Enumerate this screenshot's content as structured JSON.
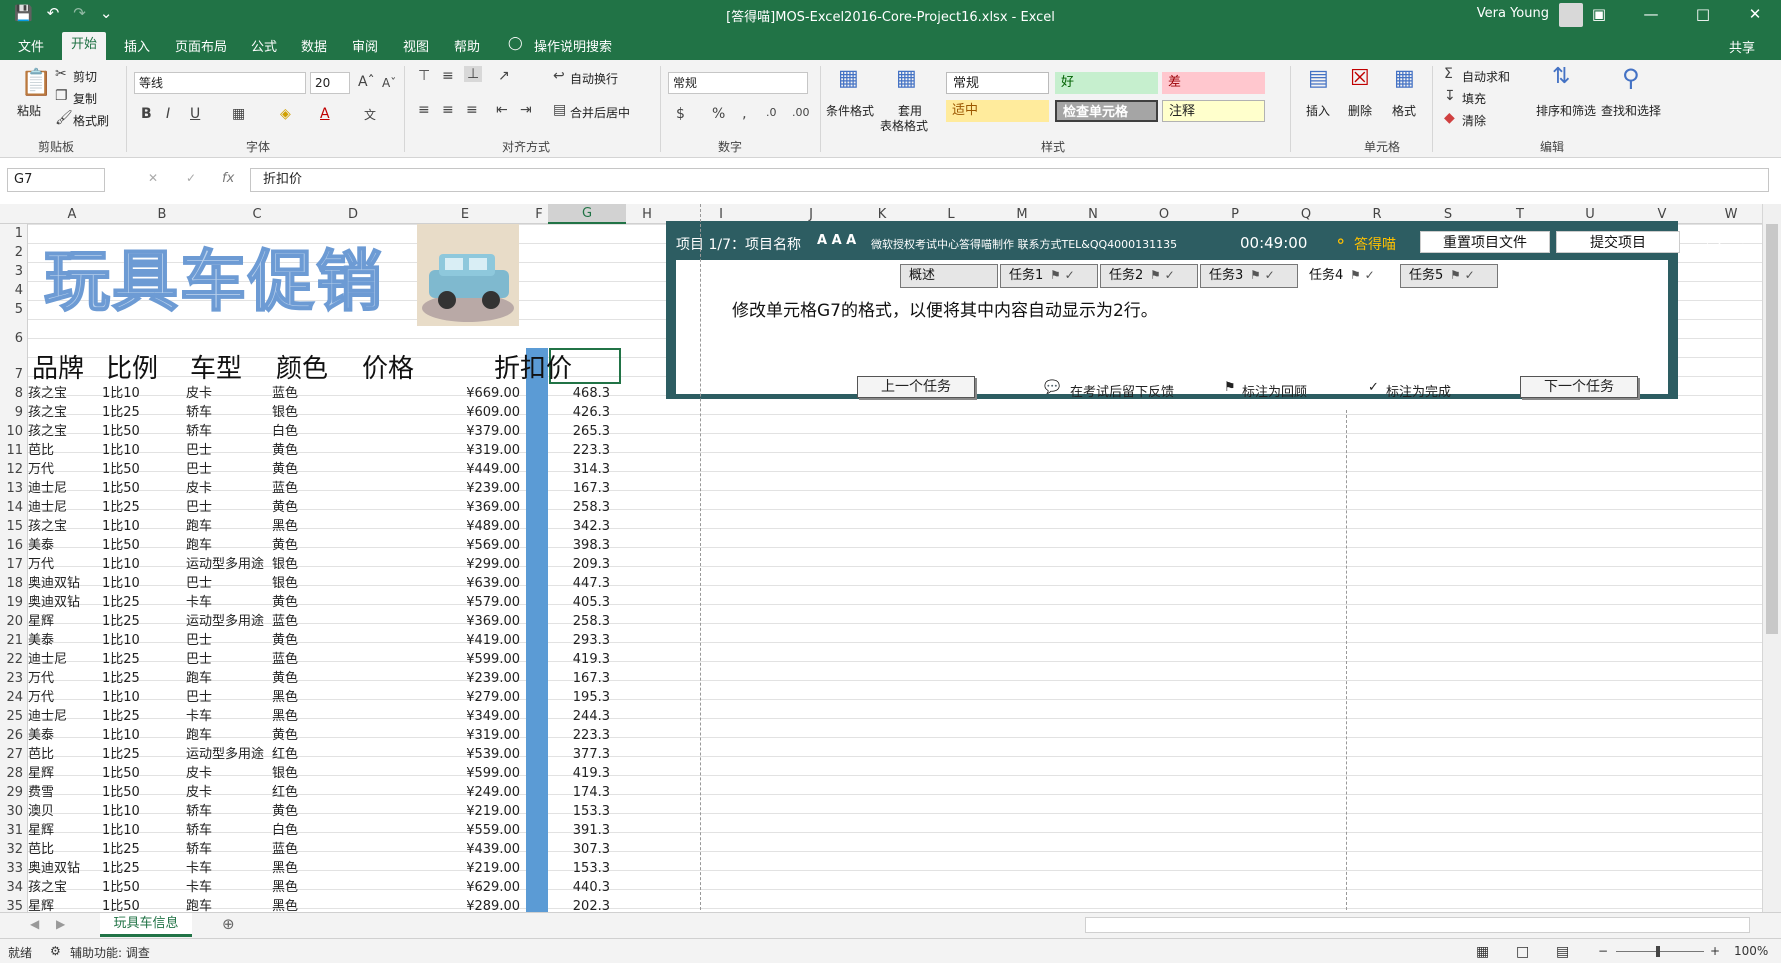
{
  "window": {
    "title": "[答得喵]MOS-Excel2016-Core-Project16.xlsx  -  Excel",
    "user": "Vera Young"
  },
  "tabs": [
    "文件",
    "开始",
    "插入",
    "页面布局",
    "公式",
    "数据",
    "审阅",
    "视图",
    "帮助",
    "操作说明搜索"
  ],
  "share": "共享",
  "ribbon": {
    "paste": "粘贴",
    "cut": "剪切",
    "copy": "复制",
    "format_painter": "格式刷",
    "clipboard": "剪贴板",
    "font_name": "等线",
    "font_size": "20",
    "font_group": "字体",
    "wrap_text": "自动换行",
    "merge_center": "合并后居中",
    "align_group": "对齐方式",
    "number_format": "常规",
    "number_group": "数字",
    "cond_format": "条件格式",
    "table_format_1": "套用",
    "table_format_2": "表格格式",
    "styles": {
      "normal": "常规",
      "good": "好",
      "bad": "差",
      "neutral": "适中",
      "check_cell": "检查单元格",
      "note": "注释"
    },
    "styles_group": "样式",
    "insert": "插入",
    "delete": "删除",
    "format": "格式",
    "cells_group": "单元格",
    "autosum": "自动求和",
    "fill": "填充",
    "clear": "清除",
    "sort_filter": "排序和筛选",
    "find_select": "查找和选择",
    "edit_group": "编辑"
  },
  "formula_bar": {
    "name_box": "G7",
    "fx": "fx",
    "content": "折扣价"
  },
  "columns": [
    "A",
    "B",
    "C",
    "D",
    "E",
    "F",
    "G",
    "H",
    "I",
    "J",
    "K",
    "L",
    "M",
    "N",
    "O",
    "P",
    "Q",
    "R",
    "S",
    "T",
    "U",
    "V",
    "W"
  ],
  "sheet_title": "玩具车促销",
  "headers": [
    "品牌",
    "比例",
    "车型",
    "颜色",
    "价格",
    "折扣价"
  ],
  "rows": [
    [
      "孩之宝",
      "1比10",
      "皮卡",
      "蓝色",
      "¥669.00",
      "468.3"
    ],
    [
      "孩之宝",
      "1比25",
      "轿车",
      "银色",
      "¥609.00",
      "426.3"
    ],
    [
      "孩之宝",
      "1比50",
      "轿车",
      "白色",
      "¥379.00",
      "265.3"
    ],
    [
      "芭比",
      "1比10",
      "巴士",
      "黄色",
      "¥319.00",
      "223.3"
    ],
    [
      "万代",
      "1比50",
      "巴士",
      "黄色",
      "¥449.00",
      "314.3"
    ],
    [
      "迪士尼",
      "1比50",
      "皮卡",
      "蓝色",
      "¥239.00",
      "167.3"
    ],
    [
      "迪士尼",
      "1比25",
      "巴士",
      "黄色",
      "¥369.00",
      "258.3"
    ],
    [
      "孩之宝",
      "1比10",
      "跑车",
      "黑色",
      "¥489.00",
      "342.3"
    ],
    [
      "美泰",
      "1比50",
      "跑车",
      "黄色",
      "¥569.00",
      "398.3"
    ],
    [
      "万代",
      "1比10",
      "运动型多用途",
      "银色",
      "¥299.00",
      "209.3"
    ],
    [
      "奥迪双钻",
      "1比10",
      "巴士",
      "银色",
      "¥639.00",
      "447.3"
    ],
    [
      "奥迪双钻",
      "1比25",
      "卡车",
      "黄色",
      "¥579.00",
      "405.3"
    ],
    [
      "星辉",
      "1比25",
      "运动型多用途",
      "蓝色",
      "¥369.00",
      "258.3"
    ],
    [
      "美泰",
      "1比10",
      "巴士",
      "黄色",
      "¥419.00",
      "293.3"
    ],
    [
      "迪士尼",
      "1比25",
      "巴士",
      "蓝色",
      "¥599.00",
      "419.3"
    ],
    [
      "万代",
      "1比25",
      "跑车",
      "黄色",
      "¥239.00",
      "167.3"
    ],
    [
      "万代",
      "1比10",
      "巴士",
      "黑色",
      "¥279.00",
      "195.3"
    ],
    [
      "迪士尼",
      "1比25",
      "卡车",
      "黑色",
      "¥349.00",
      "244.3"
    ],
    [
      "美泰",
      "1比10",
      "跑车",
      "黄色",
      "¥319.00",
      "223.3"
    ],
    [
      "芭比",
      "1比25",
      "运动型多用途",
      "红色",
      "¥539.00",
      "377.3"
    ],
    [
      "星辉",
      "1比50",
      "皮卡",
      "银色",
      "¥599.00",
      "419.3"
    ],
    [
      "费雪",
      "1比50",
      "皮卡",
      "红色",
      "¥249.00",
      "174.3"
    ],
    [
      "澳贝",
      "1比10",
      "轿车",
      "黄色",
      "¥219.00",
      "153.3"
    ],
    [
      "星辉",
      "1比10",
      "轿车",
      "白色",
      "¥559.00",
      "391.3"
    ],
    [
      "芭比",
      "1比25",
      "轿车",
      "蓝色",
      "¥439.00",
      "307.3"
    ],
    [
      "奥迪双钻",
      "1比25",
      "卡车",
      "黑色",
      "¥219.00",
      "153.3"
    ],
    [
      "孩之宝",
      "1比50",
      "卡车",
      "黑色",
      "¥629.00",
      "440.3"
    ],
    [
      "星辉",
      "1比50",
      "跑车",
      "黑色",
      "¥289.00",
      "202.3"
    ]
  ],
  "task_panel": {
    "project": "项目 1/7：项目名称",
    "font_sizes": "A A A",
    "credit": "微软授权考试中心答得喵制作 联系方式TEL&QQ4000131135",
    "timer": "00:49:00",
    "brand": "答得喵",
    "reset": "重置项目文件",
    "submit": "提交项目",
    "tabs": [
      "概述",
      "任务1",
      "任务2",
      "任务3",
      "任务4",
      "任务5"
    ],
    "task_text": "修改单元格G7的格式，以便将其中内容自动显示为2行。",
    "prev": "上一个任务",
    "feedback": "在考试后留下反馈",
    "mark_review": "标注为回顾",
    "mark_done": "标注为完成",
    "next": "下一个任务"
  },
  "sheet_tab": "玩具车信息",
  "status": {
    "ready": "就绪",
    "accessibility": "辅助功能: 调查",
    "zoom": "100%"
  },
  "colors": {
    "excel_green": "#217346",
    "panel_teal": "#2d5d62",
    "title_fill": "#b8d0ec"
  }
}
